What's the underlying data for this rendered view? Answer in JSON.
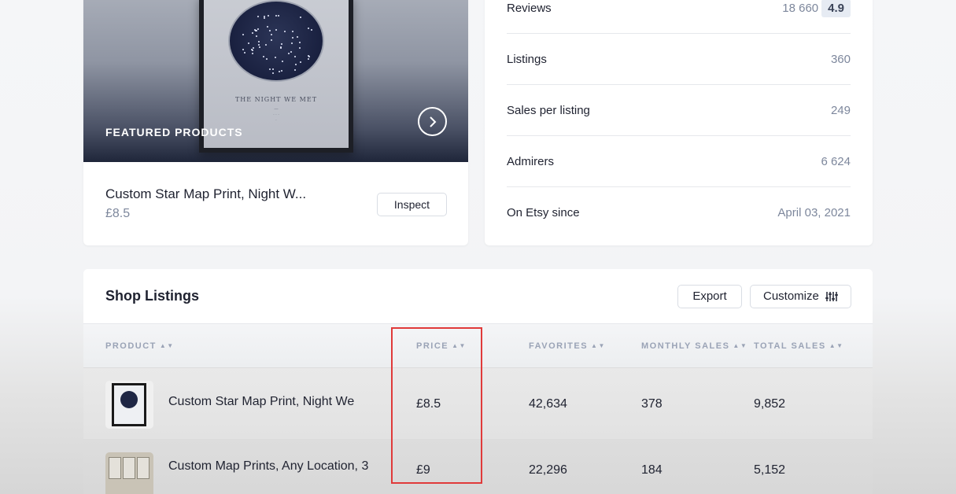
{
  "featured": {
    "poster_caption": "THE NIGHT WE MET",
    "label": "FEATURED PRODUCTS",
    "product_title": "Custom Star Map Print, Night W...",
    "product_price": "£8.5",
    "inspect_label": "Inspect",
    "next_icon": "chevron-right-icon"
  },
  "stats": [
    {
      "label": "Reviews",
      "value": "18 660",
      "badge": "4.9"
    },
    {
      "label": "Listings",
      "value": "360"
    },
    {
      "label": "Sales per listing",
      "value": "249"
    },
    {
      "label": "Admirers",
      "value": "6 624"
    },
    {
      "label": "On Etsy since",
      "value": "April 03, 2021"
    }
  ],
  "listings": {
    "title": "Shop Listings",
    "export_label": "Export",
    "customize_label": "Customize",
    "columns": [
      "PRODUCT",
      "PRICE",
      "FAVORITES",
      "MONTHLY SALES",
      "TOTAL SALES"
    ],
    "rows": [
      {
        "product": "Custom Star Map Print, Night We",
        "price": "£8.5",
        "favorites": "42,634",
        "monthly_sales": "378",
        "total_sales": "9,852"
      },
      {
        "product": "Custom Map Prints, Any Location, 3",
        "price": "£9",
        "favorites": "22,296",
        "monthly_sales": "184",
        "total_sales": "5,152"
      }
    ]
  },
  "colors": {
    "highlight": "#e03a3a",
    "muted_text": "#7d879c",
    "header_text": "#9aa3b6"
  }
}
